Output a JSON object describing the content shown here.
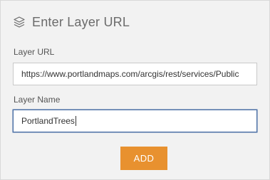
{
  "dialog": {
    "title": "Enter Layer URL",
    "title_icon": "layers-icon"
  },
  "layer_url": {
    "label": "Layer URL",
    "value": "https://www.portlandmaps.com/arcgis/rest/services/Public"
  },
  "layer_name": {
    "label": "Layer Name",
    "value": "PortlandTrees"
  },
  "add_button": {
    "label": "ADD"
  },
  "colors": {
    "accent": "#e8912f",
    "panel_bg": "#f2f2f2",
    "focus_border": "#4a6fa5"
  }
}
